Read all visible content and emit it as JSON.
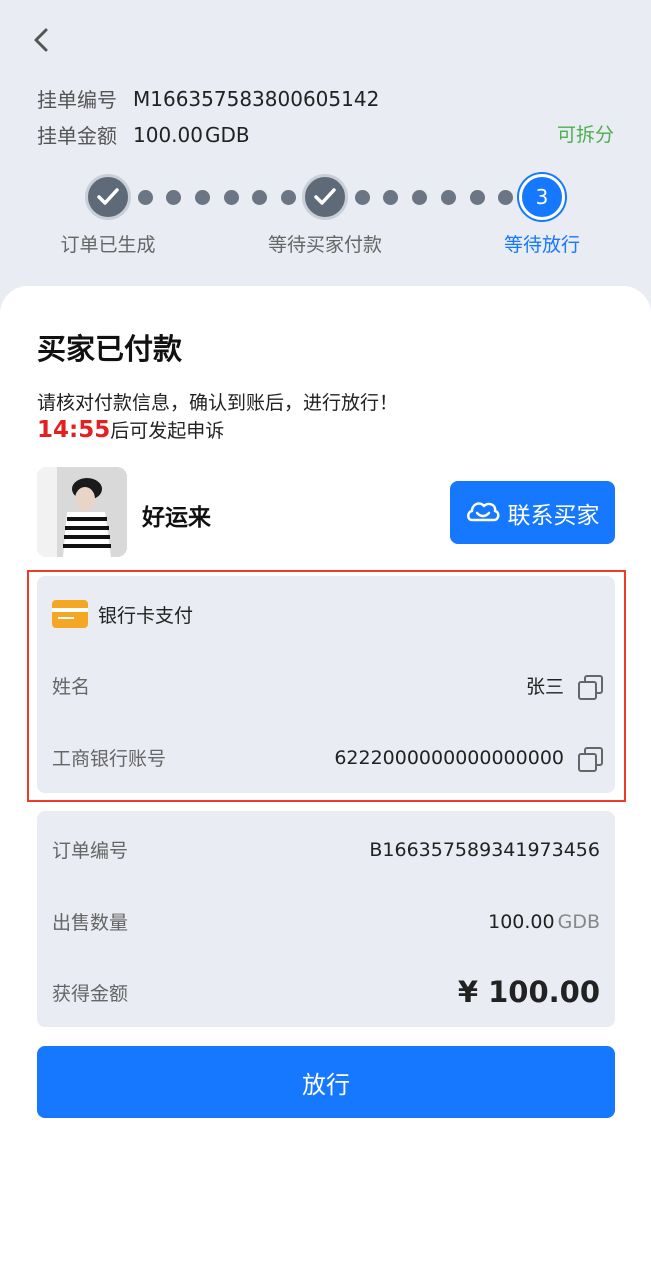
{
  "header": {
    "order_label": "挂单编号",
    "order_value": "M166357583800605142",
    "amount_label": "挂单金额",
    "amount_value": "100.00",
    "amount_unit": "GDB",
    "splittable": "可拆分"
  },
  "steps": {
    "items": [
      {
        "label": "订单已生成",
        "state": "done"
      },
      {
        "label": "等待买家付款",
        "state": "done"
      },
      {
        "label": "等待放行",
        "state": "current",
        "number": "3"
      }
    ]
  },
  "status": {
    "title": "买家已付款",
    "hint": "请核对付款信息，确认到账后，进行放行！",
    "timer": "14:55",
    "timer_suffix": "后可发起申诉"
  },
  "buyer": {
    "name": "好运来",
    "contact_label": "联系买家"
  },
  "payment": {
    "method": "银行卡支付",
    "name_label": "姓名",
    "name_value": "张三",
    "account_label": "工商银行账号",
    "account_value": "6222000000000000000"
  },
  "order": {
    "number_label": "订单编号",
    "number_value": "B166357589341973456",
    "qty_label": "出售数量",
    "qty_value": "100.00",
    "qty_unit": "GDB",
    "earn_label": "获得金额",
    "earn_value": "¥ 100.00"
  },
  "actions": {
    "release_label": "放行"
  },
  "colors": {
    "primary": "#1677ff",
    "timer": "#e32020",
    "splittable": "#4caf50",
    "highlight_border": "#f03a2a"
  }
}
